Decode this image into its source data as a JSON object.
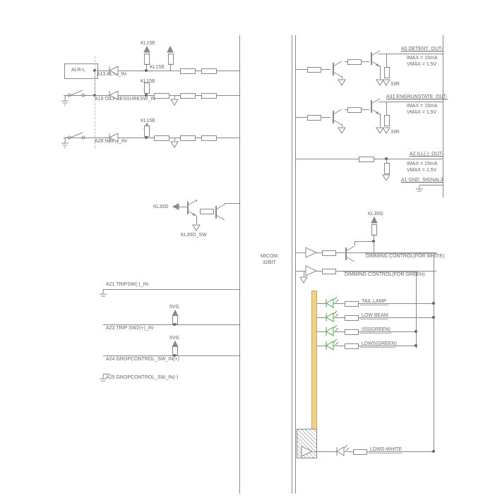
{
  "left_block": {
    "alr_label": "ALR-L",
    "signals": {
      "a13": "A13 ALTL_IN-",
      "a19": "A19 OILPRESSURESW_IN-",
      "a28": "A28 N(MT)_IN-",
      "kl15e": "KL15E",
      "kl30d": "KL30D",
      "kl30d_sw": "KL30D_SW",
      "a21": "A21 TRIPSW(-)_IN-",
      "a23": "A23 TRIP SW2(+)_IN-",
      "a24": "A24 GROPCONTROL_SW_IN(+)",
      "a25": "A25 GROPCONTROL_SW_IN(-)",
      "fivevg": "5VG"
    }
  },
  "center": {
    "micom1": "MICOM",
    "micom2": "32BIT"
  },
  "right_block": {
    "a5": "A5 DETENT_OUT-",
    "a5_p1": "IMAX = 15mA",
    "a5_p2": "VMAX = 1.5V",
    "r33": "33R",
    "a31": "A31 ENGRUNSTATE_OUT-",
    "a31_p1": "IMAX = 15mA",
    "a31_p2": "VMAX = 1.5V",
    "a2": "A2 ILL(-)_OUT-",
    "a2_p1": "IMAX = 15mA",
    "a2_p2": "VMAX = 1.5V",
    "a1": "A1 GND_SIGNAL3",
    "kl30g": "KL30G",
    "dim_white": "DIMMING CONTROL(FOR WHITE)",
    "dim_green": "DIMMING CONTROL(FOR GREEN)",
    "leds": {
      "tail": "TAIL LAMP",
      "low": "LOW BEAM",
      "iss": "ISS(GREEN)",
      "ldws": "LDWS(GREEN)",
      "ldws_white": "LDWS-WHITE"
    }
  }
}
